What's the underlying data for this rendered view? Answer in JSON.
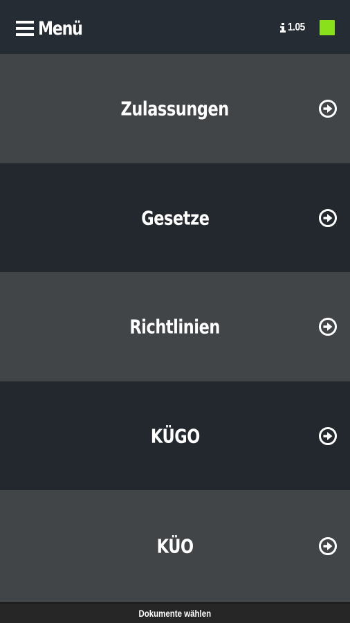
{
  "header": {
    "menu_label": "Menü",
    "menu_icon": "hamburger-icon",
    "version_icon": "info-icon",
    "version": "1.05",
    "status_color": "#8ae01a"
  },
  "menu": {
    "items": [
      {
        "label": "Zulassungen",
        "icon": "arrow-right-circle-icon"
      },
      {
        "label": "Gesetze",
        "icon": "arrow-right-circle-icon"
      },
      {
        "label": "Richtlinien",
        "icon": "arrow-right-circle-icon"
      },
      {
        "label": "KÜGO",
        "icon": "arrow-right-circle-icon"
      },
      {
        "label": "KÜO",
        "icon": "arrow-right-circle-icon"
      }
    ]
  },
  "footer": {
    "label": "Dokumente wählen"
  },
  "colors": {
    "topbar": "#262c33",
    "row_light": "#424547",
    "row_dark": "#22282e",
    "footer": "#262626",
    "status": "#8ae01a"
  }
}
